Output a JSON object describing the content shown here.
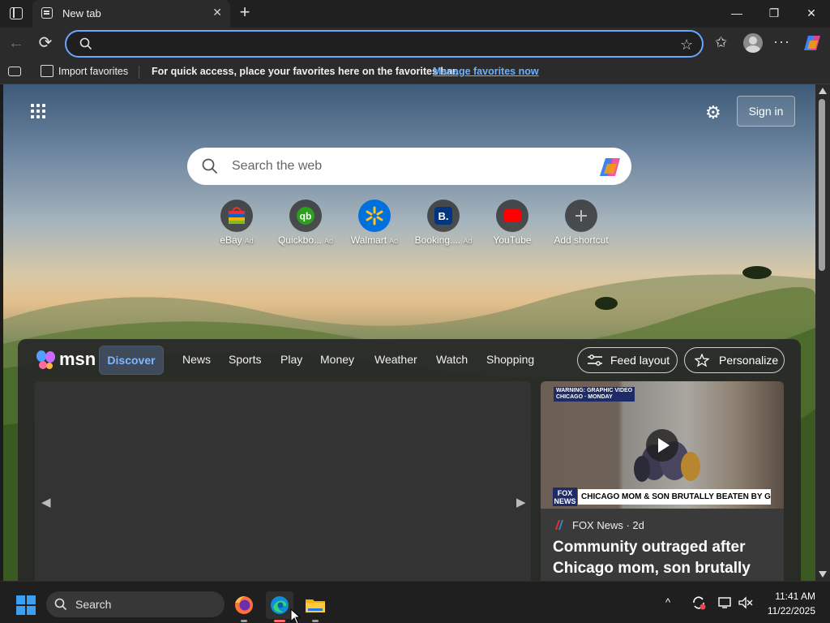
{
  "browser": {
    "tab_title": "New tab",
    "tab_close_glyph": "✕",
    "new_tab_glyph": "+",
    "window_controls": {
      "minimize": "—",
      "maximize": "❐",
      "close": "✕"
    },
    "nav": {
      "back_glyph": "←",
      "refresh_glyph": "⟳",
      "omnibox_value": "",
      "favorite_star_glyph": "☆",
      "favorites_glyph": "✩",
      "more_glyph": "···"
    },
    "favorites_bar": {
      "import_label": "Import favorites",
      "message": "For quick access, place your favorites here on the favorites bar.",
      "link_label": "Manage favorites now"
    }
  },
  "newtab": {
    "settings_glyph": "⚙",
    "sign_in_label": "Sign in",
    "search_placeholder": "Search the web",
    "shortcuts": [
      {
        "label": "eBay",
        "ad": "Ad",
        "icon": "ebay-icon"
      },
      {
        "label": "Quickbo...",
        "ad": "Ad",
        "icon": "quickbooks-icon"
      },
      {
        "label": "Walmart",
        "ad": "Ad",
        "icon": "walmart-icon"
      },
      {
        "label": "Booking....",
        "ad": "Ad",
        "icon": "booking-icon"
      },
      {
        "label": "YouTube",
        "ad": "",
        "icon": "youtube-icon"
      },
      {
        "label": "Add shortcut",
        "ad": "",
        "icon": "plus-icon"
      }
    ]
  },
  "msn": {
    "logo_text": "msn",
    "nav": [
      "Discover",
      "News",
      "Sports",
      "Play",
      "Money",
      "Weather",
      "Watch",
      "Shopping"
    ],
    "active_nav": "Discover",
    "feed_layout_label": "Feed layout",
    "personalize_label": "Personalize",
    "carousel_prev_glyph": "◀",
    "carousel_next_glyph": "▶",
    "card": {
      "warning_text": "WARNING: GRAPHIC VIDEO",
      "warning_sub": "CHICAGO · MONDAY",
      "fox_logo": "FOX NEWS",
      "chyron": "CHICAGO MOM & SON BRUTALLY BEATEN BY GROUP OF KIDS",
      "source": "FOX News · 2d",
      "headline": "Community outraged after Chicago mom, son brutally"
    }
  },
  "taskbar": {
    "search_label": "Search",
    "tray_chevron": "^",
    "time": "11:41 AM",
    "date": "11/22/2025"
  },
  "colors": {
    "accent": "#6aa6ff",
    "link": "#6cb2ff",
    "discover_active": "#7fb6ff",
    "windows_blue": "#3aa0f3"
  }
}
